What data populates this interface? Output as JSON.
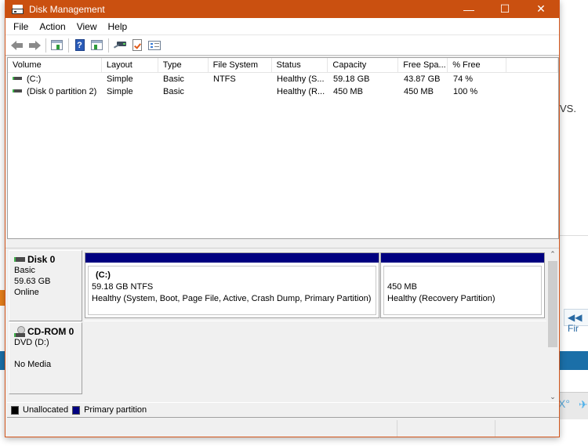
{
  "window": {
    "title": "Disk Management",
    "controls": {
      "minimize": "—",
      "maximize": "☐",
      "close": "✕"
    }
  },
  "menu": [
    "File",
    "Action",
    "View",
    "Help"
  ],
  "toolbar": {
    "buttons": [
      "back-icon",
      "forward-icon",
      "show-hide-console-tree-icon",
      "help-icon",
      "show-hide-action-pane-icon",
      "connect-drive-icon",
      "check-properties-icon",
      "list-view-icon"
    ]
  },
  "volume_table": {
    "columns": [
      "Volume",
      "Layout",
      "Type",
      "File System",
      "Status",
      "Capacity",
      "Free Spa...",
      "% Free",
      ""
    ],
    "rows": [
      {
        "volume": "(C:)",
        "layout": "Simple",
        "type": "Basic",
        "fs": "NTFS",
        "status": "Healthy (S...",
        "capacity": "59.18 GB",
        "free": "43.87 GB",
        "pct": "74 %"
      },
      {
        "volume": "(Disk 0 partition 2)",
        "layout": "Simple",
        "type": "Basic",
        "fs": "",
        "status": "Healthy (R...",
        "capacity": "450 MB",
        "free": "450 MB",
        "pct": "100 %"
      }
    ]
  },
  "disks": [
    {
      "name": "Disk 0",
      "type": "Basic",
      "size": "59.63 GB",
      "state": "Online",
      "partitions": [
        {
          "name": "(C:)",
          "size": "59.18 GB NTFS",
          "status": "Healthy (System, Boot, Page File, Active, Crash Dump, Primary Partition)"
        },
        {
          "name": "",
          "size": "450 MB",
          "status": "Healthy (Recovery Partition)"
        }
      ]
    },
    {
      "name": "CD-ROM 0",
      "type": "DVD (D:)",
      "state": "No Media"
    }
  ],
  "legend": [
    {
      "label": "Unallocated",
      "color": "#000000"
    },
    {
      "label": "Primary partition",
      "color": "#000080"
    }
  ],
  "colors": {
    "titlebar": "#ca5010",
    "primary_partition": "#000080"
  },
  "background_page": {
    "vs_text": "VS.",
    "fir_text": "◀◀ Fir",
    "x_text": "X°",
    "twitter": "🐦"
  }
}
